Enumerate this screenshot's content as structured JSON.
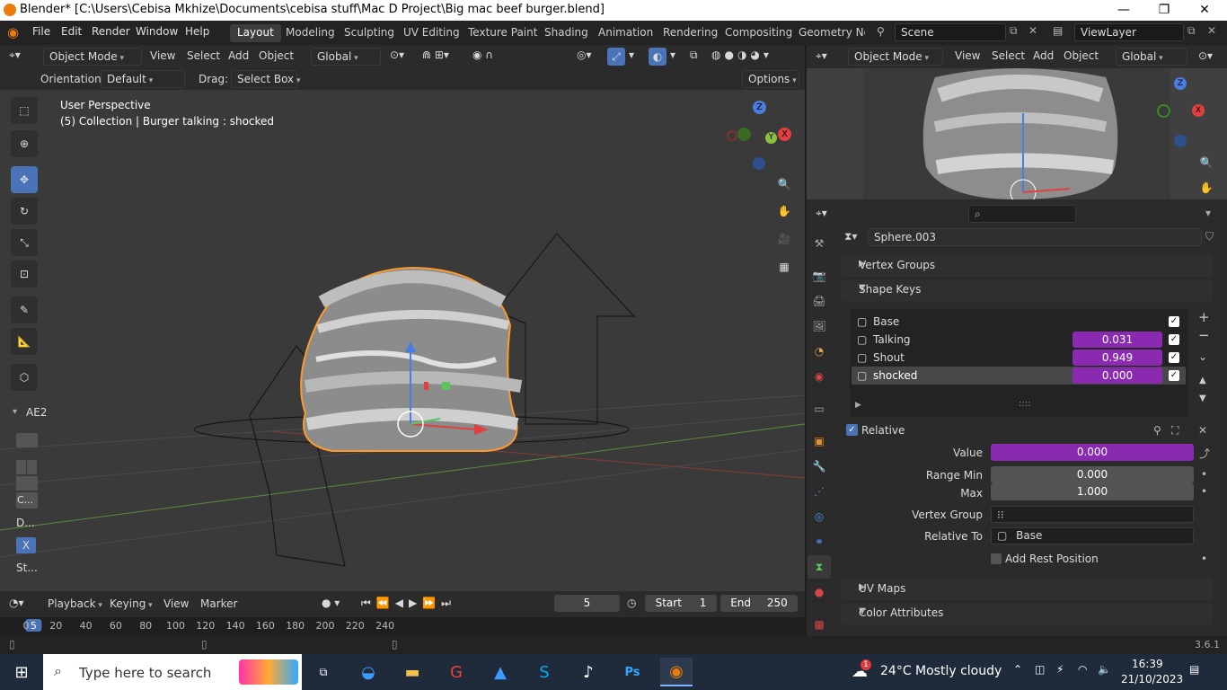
{
  "titlebar": {
    "title": "Blender* [C:\\Users\\Cebisa Mkhize\\Documents\\cebisa stuff\\Mac D Project\\Big mac beef burger.blend]",
    "minimize": "—",
    "restore": "❐",
    "close": "✕"
  },
  "menus": [
    "File",
    "Edit",
    "Render",
    "Window",
    "Help"
  ],
  "workspaces": [
    "Layout",
    "Modeling",
    "Sculpting",
    "UV Editing",
    "Texture Paint",
    "Shading",
    "Animation",
    "Rendering",
    "Compositing",
    "Geometry Noc"
  ],
  "scene": "Scene",
  "view_layer": "ViewLayer",
  "viewport": {
    "mode": "Object Mode",
    "menu": [
      "View",
      "Select",
      "Add",
      "Object"
    ],
    "orientation": "Global",
    "orientation_label": "Orientation:",
    "orientation_value": "Default",
    "drag_label": "Drag:",
    "drag_value": "Select Box",
    "options": "Options",
    "perspective": "User Perspective",
    "collection": "(5) Collection | Burger talking : shocked",
    "collection_tag": "AE2",
    "side_labels": [
      "C...",
      "D...",
      "X",
      "St..."
    ],
    "gizmo": {
      "z": "Z",
      "y": "Y",
      "x": "X"
    }
  },
  "preview": {
    "mode": "Object Mode",
    "menu": [
      "View",
      "Select",
      "Add",
      "Object"
    ],
    "orientation": "Global"
  },
  "properties": {
    "search_placeholder": "",
    "object_name": "Sphere.003",
    "vertex_groups": "Vertex Groups",
    "shape_keys": "Shape Keys",
    "keys": [
      {
        "name": "Base",
        "value": ""
      },
      {
        "name": "Talking",
        "value": "0.031"
      },
      {
        "name": "Shout",
        "value": "0.949"
      },
      {
        "name": "shocked",
        "value": "0.000"
      }
    ],
    "relative": "Relative",
    "value_label": "Value",
    "value": "0.000",
    "range_min_label": "Range Min",
    "range_min": "0.000",
    "max_label": "Max",
    "max": "1.000",
    "vertex_group_label": "Vertex Group",
    "vertex_group": "",
    "relative_to_label": "Relative To",
    "relative_to": "Base",
    "add_rest": "Add Rest Position",
    "uv_maps": "UV Maps",
    "color_attributes": "Color Attributes"
  },
  "timeline": {
    "playback": "Playback",
    "keying": "Keying",
    "view": "View",
    "marker": "Marker",
    "frame": "5",
    "start_label": "Start",
    "start": "1",
    "end_label": "End",
    "end": "250",
    "ticks": [
      "0",
      "20",
      "40",
      "60",
      "80",
      "100",
      "120",
      "140",
      "160",
      "180",
      "200",
      "220",
      "240"
    ],
    "current": "5"
  },
  "status": {
    "version": "3.6.1"
  },
  "taskbar": {
    "search_placeholder": "Type here to search",
    "weather": "24°C  Mostly cloudy",
    "time": "16:39",
    "date": "21/10/2023",
    "badge": "1"
  }
}
